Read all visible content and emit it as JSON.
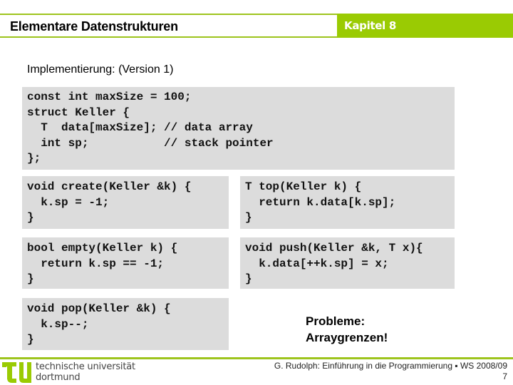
{
  "header": {
    "title": "Elementare Datenstrukturen",
    "chapter": "Kapitel 8"
  },
  "subtitle": "Implementierung: (Version 1)",
  "code_blocks": {
    "struct": "const int maxSize = 100;\nstruct Keller {\n  T  data[maxSize]; // data array\n  int sp;           // stack pointer\n};",
    "create": "void create(Keller &k) {\n  k.sp = -1;\n}",
    "top": "T top(Keller k) {\n  return k.data[k.sp];\n}",
    "empty": "bool empty(Keller k) {\n  return k.sp == -1;\n}",
    "push": "void push(Keller &k, T x){\n  k.data[++k.sp] = x;\n}",
    "pop": "void pop(Keller &k) {\n  k.sp--;\n}"
  },
  "note": {
    "line1": "Probleme:",
    "line2": "Arraygrenzen!"
  },
  "footer": {
    "logo_line1": "technische universität",
    "logo_line2": "dortmund",
    "credit": "G. Rudolph: Einführung in die Programmierung ▪ WS 2008/09",
    "page_number": "7"
  },
  "colors": {
    "accent_green": "#9acb03",
    "code_background": "#dcdcdc"
  }
}
